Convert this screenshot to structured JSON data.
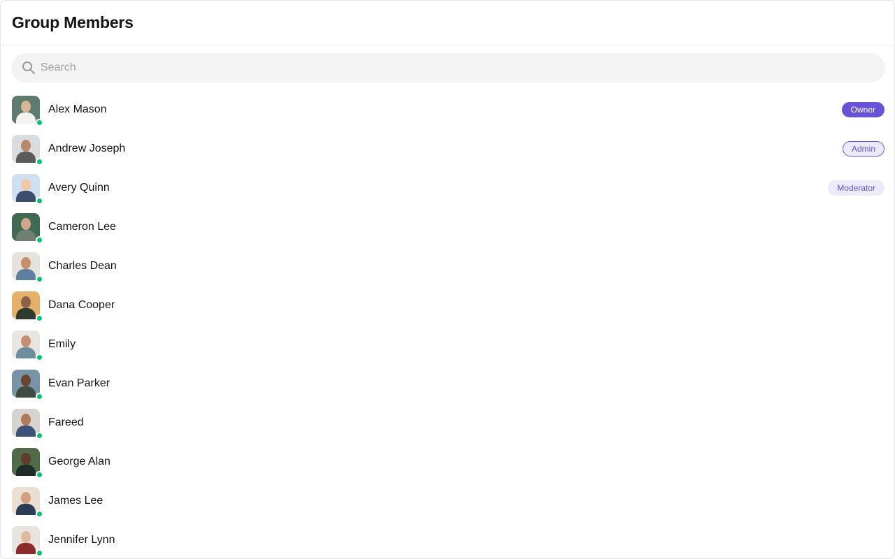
{
  "header": {
    "title": "Group Members"
  },
  "search": {
    "placeholder": "Search",
    "value": ""
  },
  "colors": {
    "accent": "#6852d6",
    "accent_light": "#edeafa",
    "online": "#09c26f"
  },
  "members": [
    {
      "name": "Alex Mason",
      "role": "Owner",
      "online": true,
      "avatar_bg": "#5f7b6e",
      "avatar_head": "#d8b596",
      "avatar_body": "#f2f2f2"
    },
    {
      "name": "Andrew Joseph",
      "role": "Admin",
      "online": true,
      "avatar_bg": "#d9dde0",
      "avatar_head": "#b98a6a",
      "avatar_body": "#5b5b5b"
    },
    {
      "name": "Avery Quinn",
      "role": "Moderator",
      "online": true,
      "avatar_bg": "#cfe0f0",
      "avatar_head": "#f0c9a8",
      "avatar_body": "#3a4d6b"
    },
    {
      "name": "Cameron Lee",
      "role": "",
      "online": true,
      "avatar_bg": "#3f6b52",
      "avatar_head": "#d2a688",
      "avatar_body": "#6f7f73"
    },
    {
      "name": "Charles Dean",
      "role": "",
      "online": true,
      "avatar_bg": "#e6e3df",
      "avatar_head": "#c98f6a",
      "avatar_body": "#5d7fa0"
    },
    {
      "name": "Dana Cooper",
      "role": "",
      "online": true,
      "avatar_bg": "#e4b06a",
      "avatar_head": "#8a6248",
      "avatar_body": "#2f3a2e"
    },
    {
      "name": "Emily",
      "role": "",
      "online": true,
      "avatar_bg": "#e9e5e1",
      "avatar_head": "#c98e72",
      "avatar_body": "#6d8e9c"
    },
    {
      "name": "Evan Parker",
      "role": "",
      "online": true,
      "avatar_bg": "#7895a7",
      "avatar_head": "#6a4532",
      "avatar_body": "#3f4a40"
    },
    {
      "name": "Fareed",
      "role": "",
      "online": true,
      "avatar_bg": "#d7d3cf",
      "avatar_head": "#b07a5b",
      "avatar_body": "#3c5277"
    },
    {
      "name": "George Alan",
      "role": "",
      "online": true,
      "avatar_bg": "#4f6b48",
      "avatar_head": "#5e3d2c",
      "avatar_body": "#1f2a2a"
    },
    {
      "name": "James Lee",
      "role": "",
      "online": true,
      "avatar_bg": "#eadfd2",
      "avatar_head": "#d3a07e",
      "avatar_body": "#2a3d57"
    },
    {
      "name": "Jennifer Lynn",
      "role": "",
      "online": true,
      "avatar_bg": "#e8e4de",
      "avatar_head": "#e1b99d",
      "avatar_body": "#8b2b2b"
    }
  ]
}
